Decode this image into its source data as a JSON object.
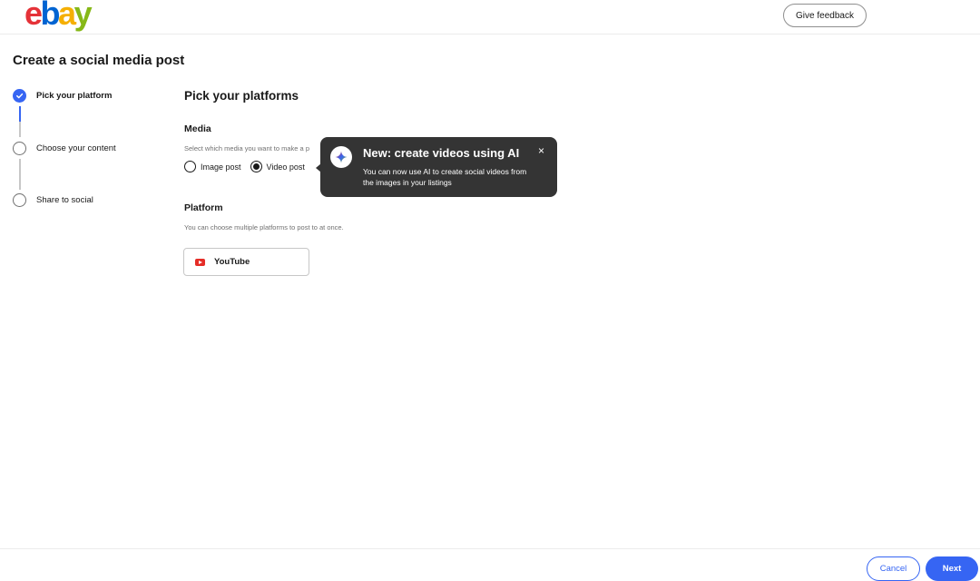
{
  "header": {
    "logo_letters": [
      "e",
      "b",
      "a",
      "y"
    ],
    "feedback_label": "Give feedback"
  },
  "page": {
    "title": "Create a social media post"
  },
  "steps": [
    {
      "label": "Pick your platform",
      "state": "done"
    },
    {
      "label": "Choose your content",
      "state": "pending"
    },
    {
      "label": "Share to social",
      "state": "pending"
    }
  ],
  "main": {
    "section_title": "Pick your platforms",
    "media": {
      "heading": "Media",
      "helper": "Select which media you want to make a p",
      "options": [
        {
          "label": "Image post",
          "selected": false
        },
        {
          "label": "Video post",
          "selected": true
        }
      ]
    },
    "platform": {
      "heading": "Platform",
      "helper": "You can choose multiple platforms to post to at once.",
      "tiles": [
        {
          "label": "YouTube",
          "icon": "youtube-icon"
        }
      ]
    }
  },
  "tooltip": {
    "title": "New: create videos using AI",
    "body": "You can now use AI to create social videos from the images in your listings",
    "close_glyph": "×",
    "icon": "sparkle-icon"
  },
  "footer": {
    "cancel_label": "Cancel",
    "next_label": "Next"
  },
  "colors": {
    "accent": "#3665f3",
    "tooltip_bg": "#343434",
    "youtube_red": "#e52d27"
  }
}
